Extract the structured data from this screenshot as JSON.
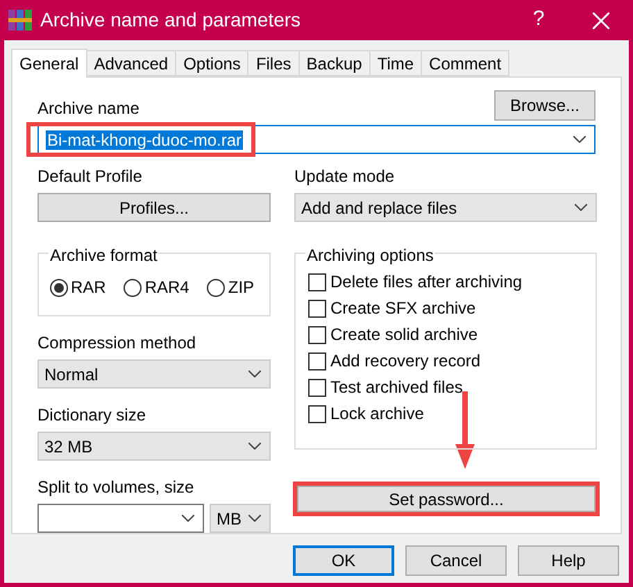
{
  "window": {
    "title": "Archive name and parameters",
    "help_button": "?"
  },
  "tabs": [
    {
      "label": "General",
      "selected": true
    },
    {
      "label": "Advanced",
      "selected": false
    },
    {
      "label": "Options",
      "selected": false
    },
    {
      "label": "Files",
      "selected": false
    },
    {
      "label": "Backup",
      "selected": false
    },
    {
      "label": "Time",
      "selected": false
    },
    {
      "label": "Comment",
      "selected": false
    }
  ],
  "archive_name": {
    "label": "Archive name",
    "browse_button": "Browse...",
    "value": "Bi-mat-khong-duoc-mo.rar",
    "selected": true
  },
  "default_profile": {
    "label": "Default Profile",
    "button": "Profiles..."
  },
  "update_mode": {
    "label": "Update mode",
    "value": "Add and replace files"
  },
  "archive_format": {
    "label": "Archive format",
    "options": [
      {
        "label": "RAR",
        "selected": true
      },
      {
        "label": "RAR4",
        "selected": false
      },
      {
        "label": "ZIP",
        "selected": false
      }
    ]
  },
  "compression_method": {
    "label": "Compression method",
    "value": "Normal"
  },
  "dictionary_size": {
    "label": "Dictionary size",
    "value": "32 MB"
  },
  "split_volumes": {
    "label": "Split to volumes, size",
    "unit": "MB"
  },
  "archiving_options": {
    "label": "Archiving options",
    "options": [
      {
        "label": "Delete files after archiving",
        "checked": false
      },
      {
        "label": "Create SFX archive",
        "checked": false
      },
      {
        "label": "Create solid archive",
        "checked": false
      },
      {
        "label": "Add recovery record",
        "checked": false
      },
      {
        "label": "Test archived files",
        "checked": false
      },
      {
        "label": "Lock archive",
        "checked": false
      }
    ]
  },
  "set_password_button": "Set password...",
  "buttons": [
    {
      "label": "OK",
      "default": true
    },
    {
      "label": "Cancel",
      "default": false
    },
    {
      "label": "Help",
      "default": false
    }
  ]
}
